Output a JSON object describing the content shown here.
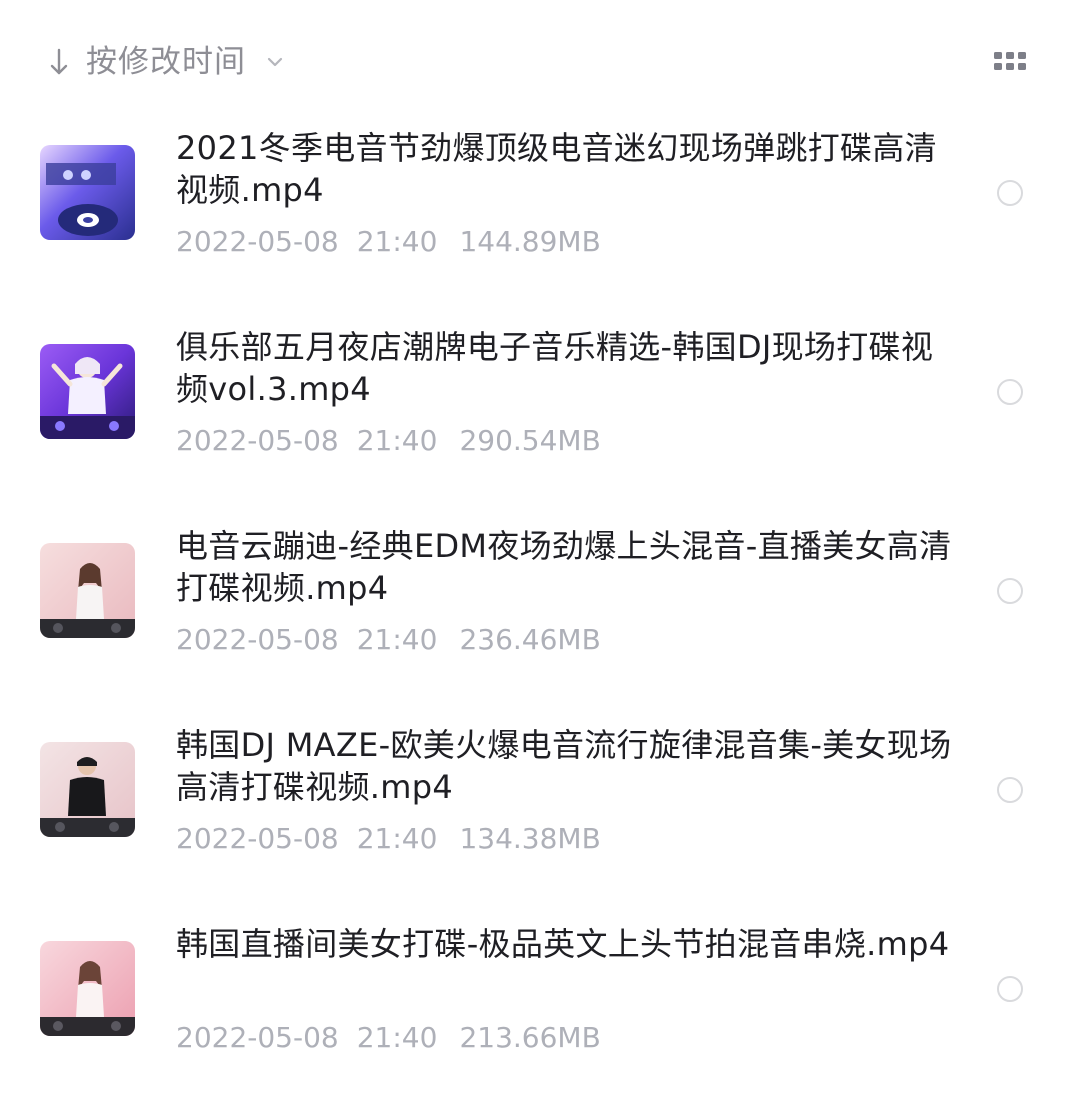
{
  "sort": {
    "label": "按修改时间",
    "arrow_icon": "arrow-down-icon",
    "dropdown_icon": "chevron-down-icon"
  },
  "view_toggle": {
    "icon": "grid-view-icon"
  },
  "colors": {
    "primary_text": "#1f1f24",
    "secondary_text": "#aeb0b8",
    "sort_text": "#8e8e95",
    "radio_border": "#d9dadd"
  },
  "files": [
    {
      "name": "2021冬季电音节劲爆顶级电音迷幻现场弹跳打碟高清视频.mp4",
      "date": "2022-05-08",
      "time": "21:40",
      "size": "144.89MB",
      "thumbnail": "dj-turntable-thumbnail"
    },
    {
      "name": "俱乐部五月夜店潮牌电子音乐精选-韩国DJ现场打碟视频vol.3.mp4",
      "date": "2022-05-08",
      "time": "21:40",
      "size": "290.54MB",
      "thumbnail": "club-dj-performer-thumbnail"
    },
    {
      "name": "电音云蹦迪-经典EDM夜场劲爆上头混音-直播美女高清打碟视频.mp4",
      "date": "2022-05-08",
      "time": "21:40",
      "size": "236.46MB",
      "thumbnail": "female-dj-pink-thumbnail"
    },
    {
      "name": "韩国DJ MAZE-欧美火爆电音流行旋律混音集-美女现场高清打碟视频.mp4",
      "date": "2022-05-08",
      "time": "21:40",
      "size": "134.38MB",
      "thumbnail": "dj-maze-thumbnail"
    },
    {
      "name": "韩国直播间美女打碟-极品英文上头节拍混音串烧.mp4",
      "date": "2022-05-08",
      "time": "21:40",
      "size": "213.66MB",
      "thumbnail": "female-dj-livestream-thumbnail"
    }
  ]
}
